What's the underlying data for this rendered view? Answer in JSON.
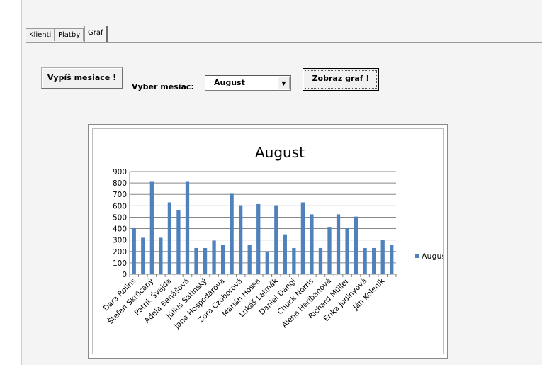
{
  "tabs": [
    {
      "label": "Klienti",
      "active": false
    },
    {
      "label": "Platby",
      "active": false
    },
    {
      "label": "Graf",
      "active": true
    }
  ],
  "controls": {
    "list_months_button": "Vypíš mesiace !",
    "select_label": "Vyber mesiac:",
    "selected_month": "August",
    "show_graph_button": "Zobraz graf !"
  },
  "colors": {
    "bar": "#4f81bd",
    "gridline": "#888888"
  },
  "chart_data": {
    "type": "bar",
    "title": "August",
    "ylim": [
      0,
      900
    ],
    "yticks": [
      0,
      100,
      200,
      300,
      400,
      500,
      600,
      700,
      800,
      900
    ],
    "grid": true,
    "legend_position": "right",
    "labeled_categories": [
      "Dara Rolins",
      "Štefan Skrúcaný",
      "Patrik Švajda",
      "Adela Banášová",
      "Július Satinský",
      "Jana Hospodárová",
      "Zora Czoborová",
      "Marián Hossa",
      "Lukáš Latinák",
      "Daniel Dangl",
      "Chuck Norris",
      "Alena Heribanová",
      "Richard Müller",
      "Erika Judinyová",
      "Ján Kolenik"
    ],
    "series": [
      {
        "name": "August",
        "values": [
          410,
          320,
          810,
          320,
          630,
          560,
          810,
          230,
          230,
          295,
          260,
          705,
          605,
          255,
          615,
          200,
          605,
          350,
          230,
          630,
          525,
          230,
          415,
          525,
          410,
          505,
          230,
          230,
          300,
          260
        ]
      }
    ]
  }
}
